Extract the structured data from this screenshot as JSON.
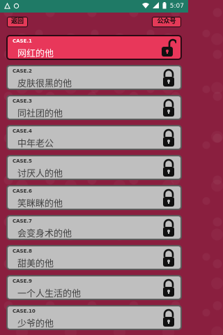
{
  "status_bar": {
    "time": "5:07"
  },
  "header": {
    "back_label": "返回",
    "account_label": "公众号"
  },
  "cases": [
    {
      "label": "CASE.1",
      "title": "网红的他",
      "unlocked": true
    },
    {
      "label": "CASE.2",
      "title": "皮肤很黑的他",
      "unlocked": false
    },
    {
      "label": "CASE.3",
      "title": "同社团的他",
      "unlocked": false
    },
    {
      "label": "CASE.4",
      "title": "中年老公",
      "unlocked": false
    },
    {
      "label": "CASE.5",
      "title": "讨厌人的他",
      "unlocked": false
    },
    {
      "label": "CASE.6",
      "title": "笑眯眯的他",
      "unlocked": false
    },
    {
      "label": "CASE.7",
      "title": "会变身术的他",
      "unlocked": false
    },
    {
      "label": "CASE.8",
      "title": "甜美的他",
      "unlocked": false
    },
    {
      "label": "CASE.9",
      "title": "一个人生活的他",
      "unlocked": false
    },
    {
      "label": "CASE.10",
      "title": "少爷的他",
      "unlocked": false
    }
  ],
  "colors": {
    "background": "#8a1f3f",
    "status_bar": "#1f7a66",
    "active_card": "#e8375a",
    "locked_card": "#bfbfbf",
    "button": "#e33a58"
  }
}
